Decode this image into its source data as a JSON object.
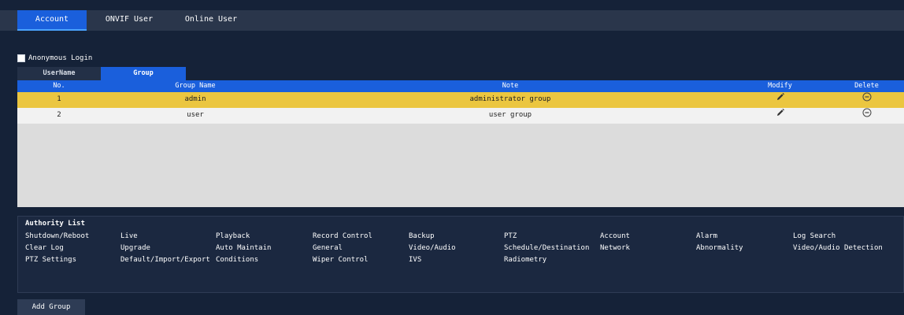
{
  "tabs": [
    {
      "label": "Account",
      "active": true
    },
    {
      "label": "ONVIF User",
      "active": false
    },
    {
      "label": "Online User",
      "active": false
    }
  ],
  "anonymous_login": {
    "label": "Anonymous Login",
    "checked": false
  },
  "subtabs": [
    {
      "label": "UserName",
      "active": false
    },
    {
      "label": "Group",
      "active": true
    }
  ],
  "table": {
    "headers": {
      "no": "No.",
      "name": "Group Name",
      "note": "Note",
      "modify": "Modify",
      "delete": "Delete"
    },
    "rows": [
      {
        "no": "1",
        "name": "admin",
        "note": "administrator group",
        "selected": true
      },
      {
        "no": "2",
        "name": "user",
        "note": "user group",
        "selected": false
      }
    ]
  },
  "authority": {
    "title": "Authority List",
    "rows": [
      [
        "Shutdown/Reboot",
        "Live",
        "Playback",
        "Record Control",
        "Backup",
        "PTZ",
        "Account",
        "Alarm",
        "Log Search"
      ],
      [
        "Clear Log",
        "Upgrade",
        "Auto Maintain",
        "General",
        "Video/Audio",
        "Schedule/Destination",
        "Network",
        "Abnormality",
        "Video/Audio Detection"
      ],
      [
        "PTZ Settings",
        "Default/Import/Export",
        "Conditions",
        "Wiper Control",
        "IVS",
        "Radiometry"
      ]
    ]
  },
  "add_group_label": "Add Group",
  "colors": {
    "background": "#152238",
    "accent": "#1a5fdc",
    "selected_row": "#ebc640"
  },
  "icons": {
    "modify": "pencil-icon",
    "delete": "minus-circle-icon"
  }
}
